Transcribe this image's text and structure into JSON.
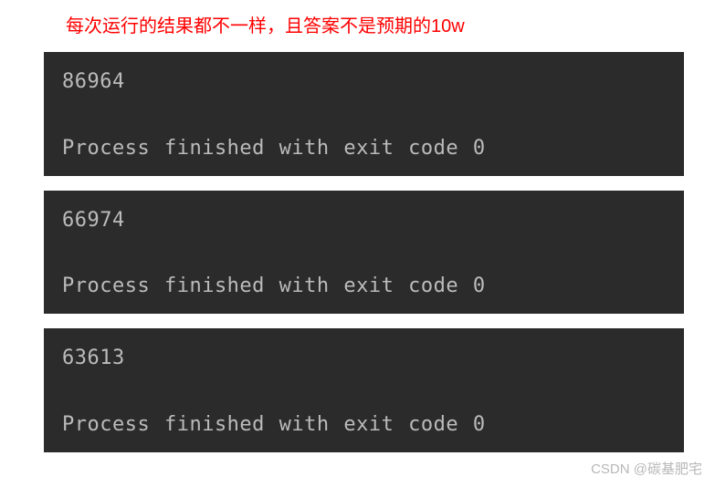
{
  "caption": "每次运行的结果都不一样，且答案不是预期的10w",
  "blocks": [
    {
      "number": "86964",
      "finish": "Process finished with exit code 0"
    },
    {
      "number": "66974",
      "finish": "Process finished with exit code 0"
    },
    {
      "number": "63613",
      "finish": "Process finished with exit code 0"
    }
  ],
  "watermark": "CSDN @碳基肥宅"
}
